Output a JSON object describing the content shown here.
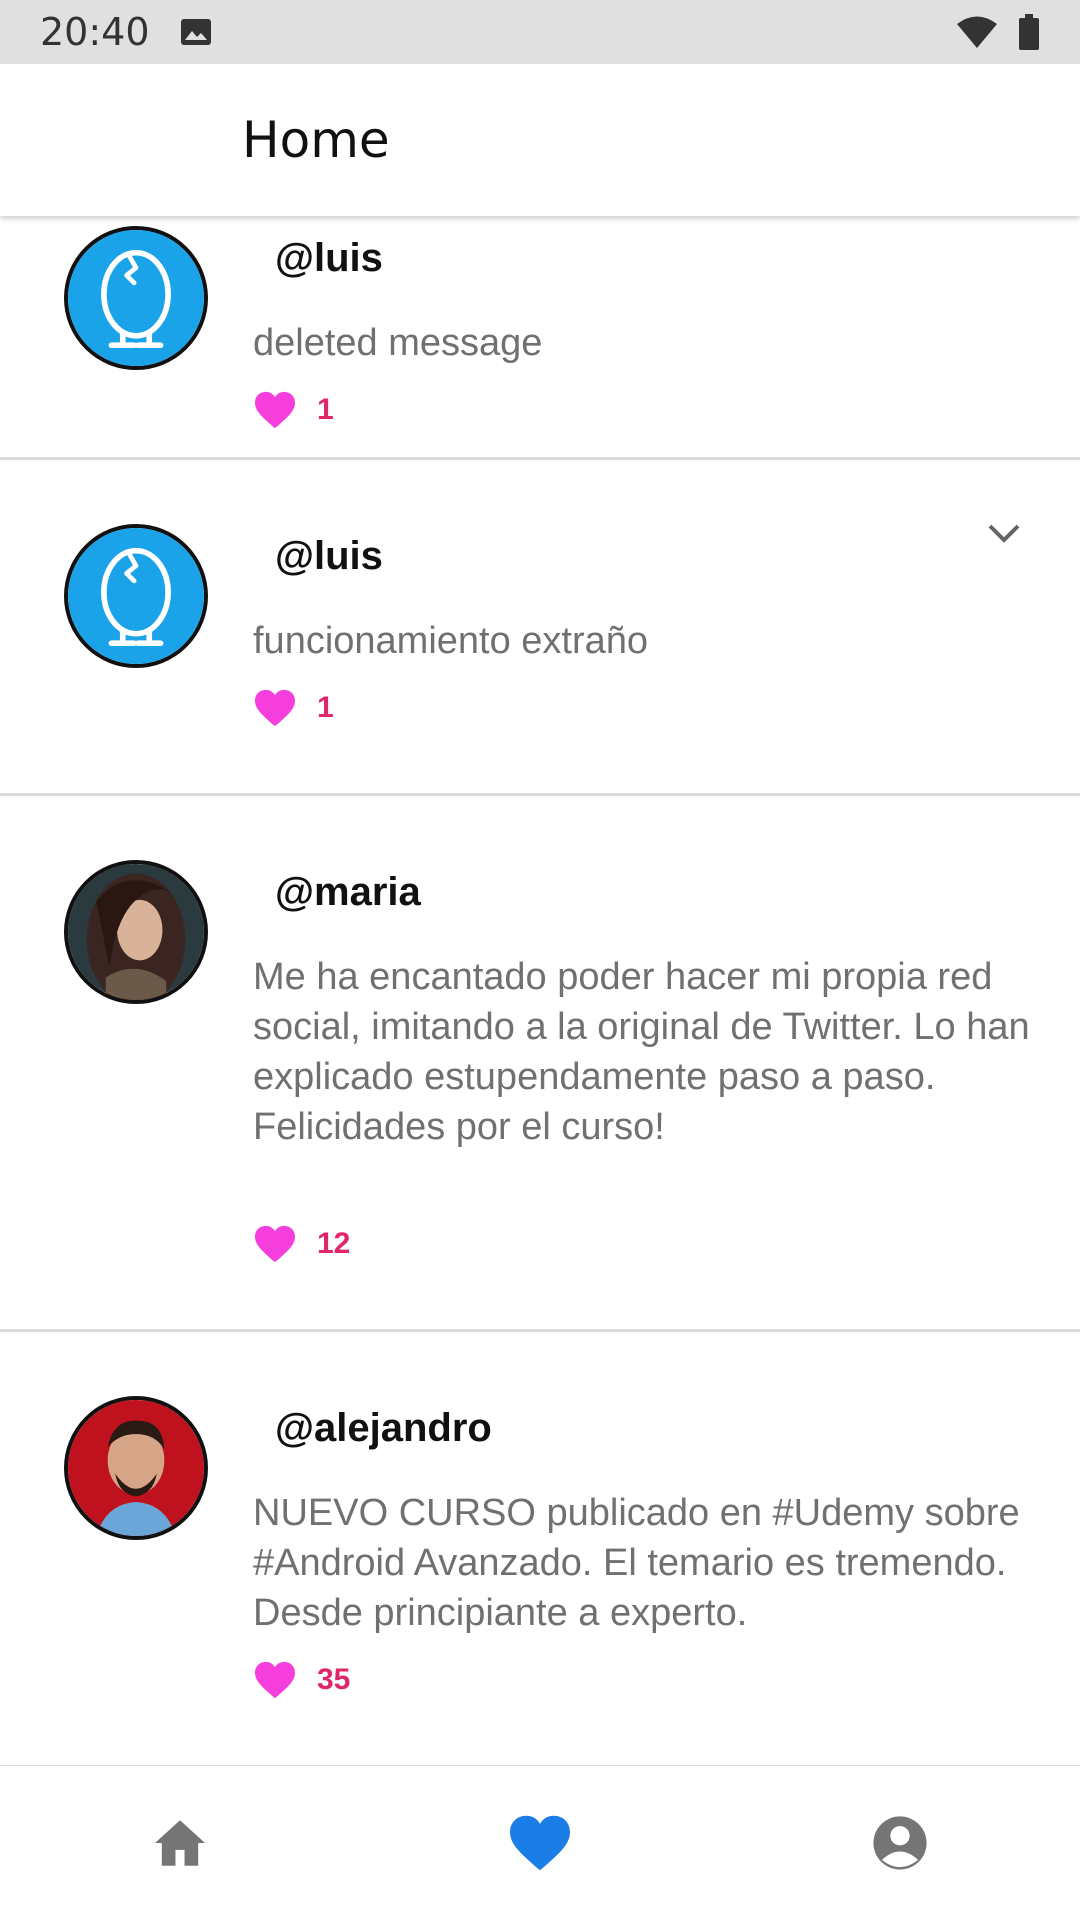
{
  "status_bar": {
    "time": "20:40",
    "icons": [
      "image-icon",
      "wifi-icon",
      "battery-icon"
    ]
  },
  "toolbar": {
    "title": "Home"
  },
  "colors": {
    "heart": "#f53edb",
    "like_count": "#e0256b",
    "nav_active": "#1a7ee6",
    "nav_inactive": "#757575",
    "egg_bg": "#1aa3e8"
  },
  "tweets": [
    {
      "username": "@luis",
      "message": "deleted message",
      "likes": "1",
      "avatar": "egg-avatar"
    },
    {
      "username": "@luis",
      "message": "funcionamiento extraño",
      "likes": "1",
      "avatar": "egg-avatar",
      "has_menu": true
    },
    {
      "username": "@maria",
      "message": "Me ha encantado poder hacer mi propia red social, imitando a la original de Twitter. Lo han explicado estupendamente paso a paso. Felicidades por el curso!",
      "likes": "12",
      "avatar": "photo-avatar-woman"
    },
    {
      "username": "@alejandro",
      "message": "NUEVO CURSO publicado en #Udemy sobre #Android Avanzado. El temario es tremendo. Desde principiante a experto.",
      "likes": "35",
      "avatar": "photo-avatar-man"
    }
  ],
  "bottom_nav": [
    {
      "icon": "home-icon",
      "active": false
    },
    {
      "icon": "heart-icon",
      "active": true
    },
    {
      "icon": "account-icon",
      "active": false
    }
  ]
}
